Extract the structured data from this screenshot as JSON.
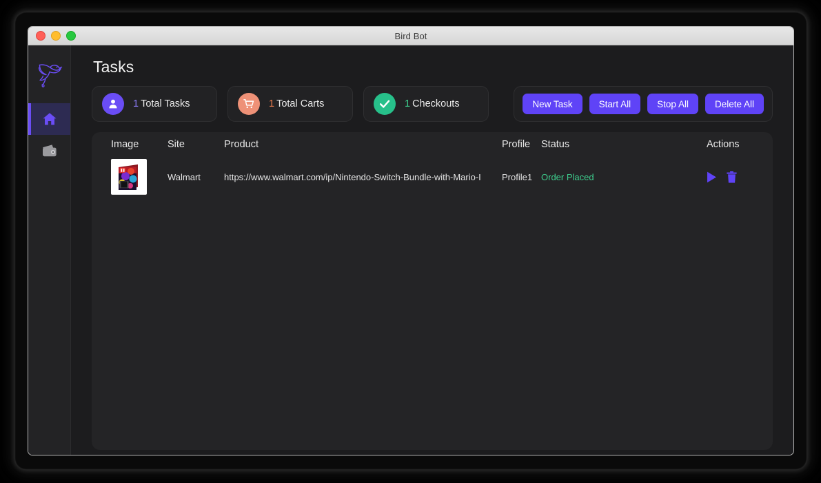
{
  "window": {
    "title": "Bird Bot",
    "traffic_lights": [
      "close",
      "minimize",
      "maximize"
    ]
  },
  "sidebar": {
    "logo": "bird-logo",
    "items": [
      {
        "id": "home",
        "icon": "home-icon",
        "active": true
      },
      {
        "id": "wallet",
        "icon": "wallet-icon",
        "active": false
      }
    ]
  },
  "main": {
    "page_title": "Tasks",
    "stats": [
      {
        "id": "total-tasks",
        "icon": "user-icon",
        "icon_bg": "#6a4df5",
        "count": "1",
        "count_color": "#8b7bf7",
        "label": "Total Tasks"
      },
      {
        "id": "total-carts",
        "icon": "cart-icon",
        "icon_bg": "#ee9177",
        "count": "1",
        "count_color": "#e87b4d",
        "label": "Total Carts"
      },
      {
        "id": "checkouts",
        "icon": "check-icon",
        "icon_bg": "#27c08a",
        "count": "1",
        "count_color": "#3ecf8e",
        "label": "Checkouts"
      }
    ],
    "buttons": [
      {
        "id": "new-task",
        "label": "New Task"
      },
      {
        "id": "start-all",
        "label": "Start All"
      },
      {
        "id": "stop-all",
        "label": "Stop All"
      },
      {
        "id": "delete-all",
        "label": "Delete All"
      }
    ],
    "table": {
      "columns": [
        "Image",
        "Site",
        "Product",
        "Profile",
        "Status",
        "Actions"
      ],
      "rows": [
        {
          "image": "nintendo-switch-bundle-thumbnail",
          "site": "Walmart",
          "product": "https://www.walmart.com/ip/Nintendo-Switch-Bundle-with-Mario-I",
          "profile": "Profile1",
          "status": "Order Placed",
          "status_color": "#3ecf8e",
          "actions": [
            "start-task-icon",
            "delete-task-icon"
          ]
        }
      ]
    }
  },
  "colors": {
    "accent_purple": "#5f43f7",
    "window_bg": "#1c1c1e",
    "panel_bg": "#242426",
    "sidebar_bg": "#232325",
    "success_green": "#3ecf8e",
    "cart_orange": "#ee9177"
  }
}
